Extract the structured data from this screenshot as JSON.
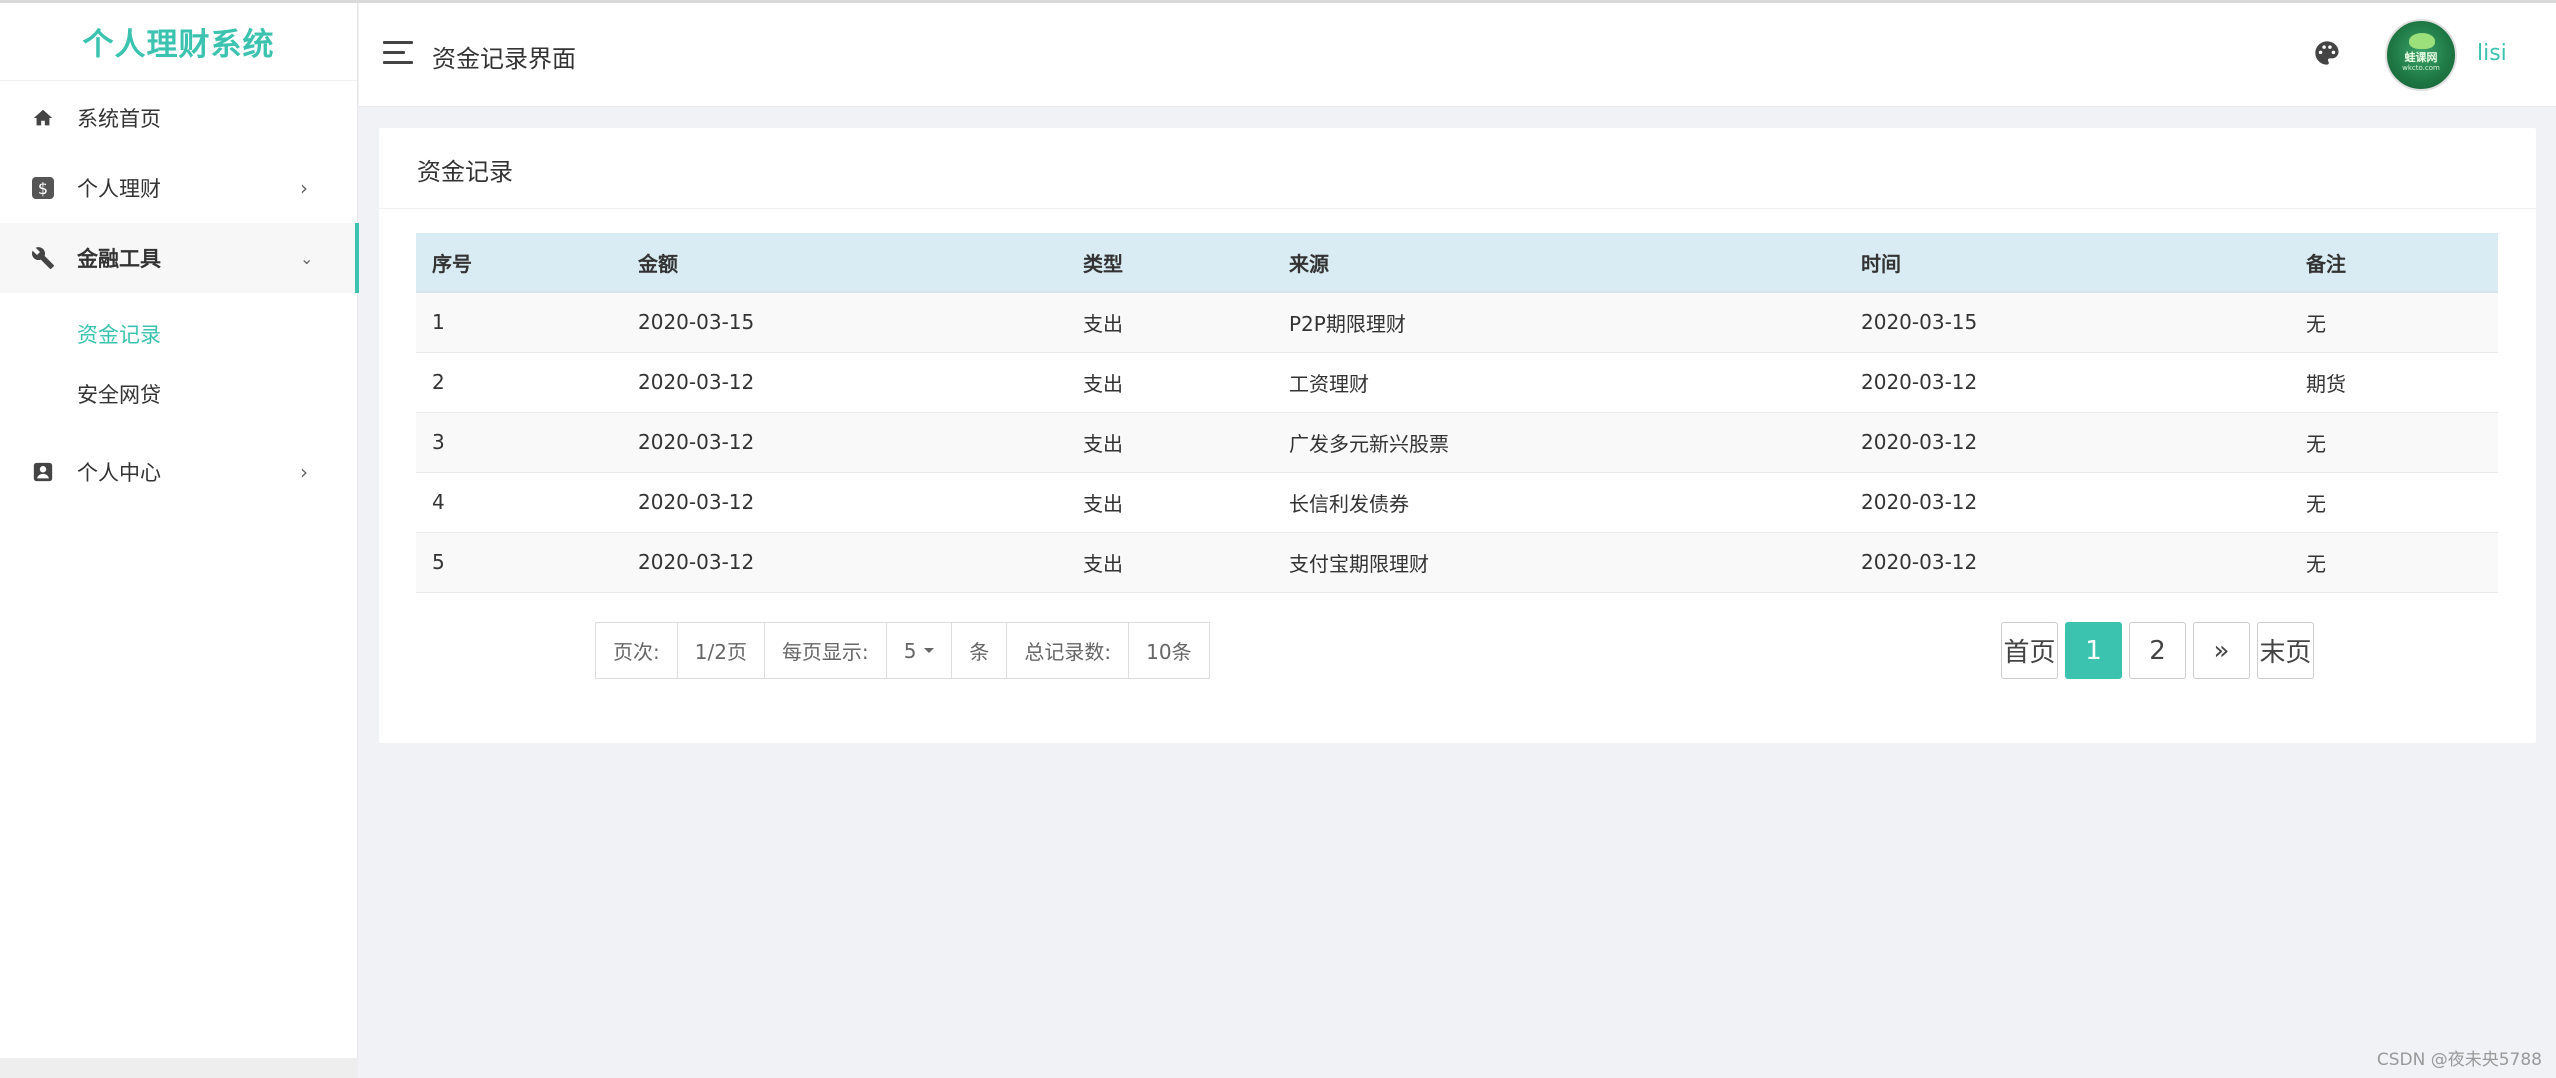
{
  "app": {
    "title": "个人理财系统"
  },
  "sidebar": {
    "items": [
      {
        "label": "系统首页",
        "icon": "home-icon"
      },
      {
        "label": "个人理财",
        "icon": "dollar-icon"
      },
      {
        "label": "金融工具",
        "icon": "wrench-icon"
      },
      {
        "label": "个人中心",
        "icon": "user-card-icon"
      }
    ],
    "sub_items": [
      {
        "label": "资金记录",
        "active": true
      },
      {
        "label": "安全网贷",
        "active": false
      }
    ]
  },
  "header": {
    "page_title": "资金记录界面",
    "username": "lisi",
    "avatar_text": "蛙课网",
    "avatar_sub": "wkcto.com"
  },
  "card": {
    "title": "资金记录"
  },
  "table": {
    "headers": [
      "序号",
      "金额",
      "类型",
      "来源",
      "时间",
      "备注"
    ],
    "rows": [
      [
        "1",
        "2020-03-15",
        "支出",
        "P2P期限理财",
        "2020-03-15",
        "无"
      ],
      [
        "2",
        "2020-03-12",
        "支出",
        "工资理财",
        "2020-03-12",
        "期货"
      ],
      [
        "3",
        "2020-03-12",
        "支出",
        "广发多元新兴股票",
        "2020-03-12",
        "无"
      ],
      [
        "4",
        "2020-03-12",
        "支出",
        "长信利发债券",
        "2020-03-12",
        "无"
      ],
      [
        "5",
        "2020-03-12",
        "支出",
        "支付宝期限理财",
        "2020-03-12",
        "无"
      ]
    ]
  },
  "pager_info": {
    "page_label": "页次:",
    "page_value": "1/2页",
    "per_page_label": "每页显示:",
    "per_page_value": "5",
    "per_page_unit": "条",
    "total_label": "总记录数:",
    "total_value": "10条"
  },
  "pagination": {
    "first": "首页",
    "pages": [
      "1",
      "2"
    ],
    "next": "»",
    "last": "末页"
  },
  "watermark": "CSDN @夜未央5788",
  "colors": {
    "accent": "#3cc3b0",
    "table_header_bg": "#d9ebf3"
  }
}
